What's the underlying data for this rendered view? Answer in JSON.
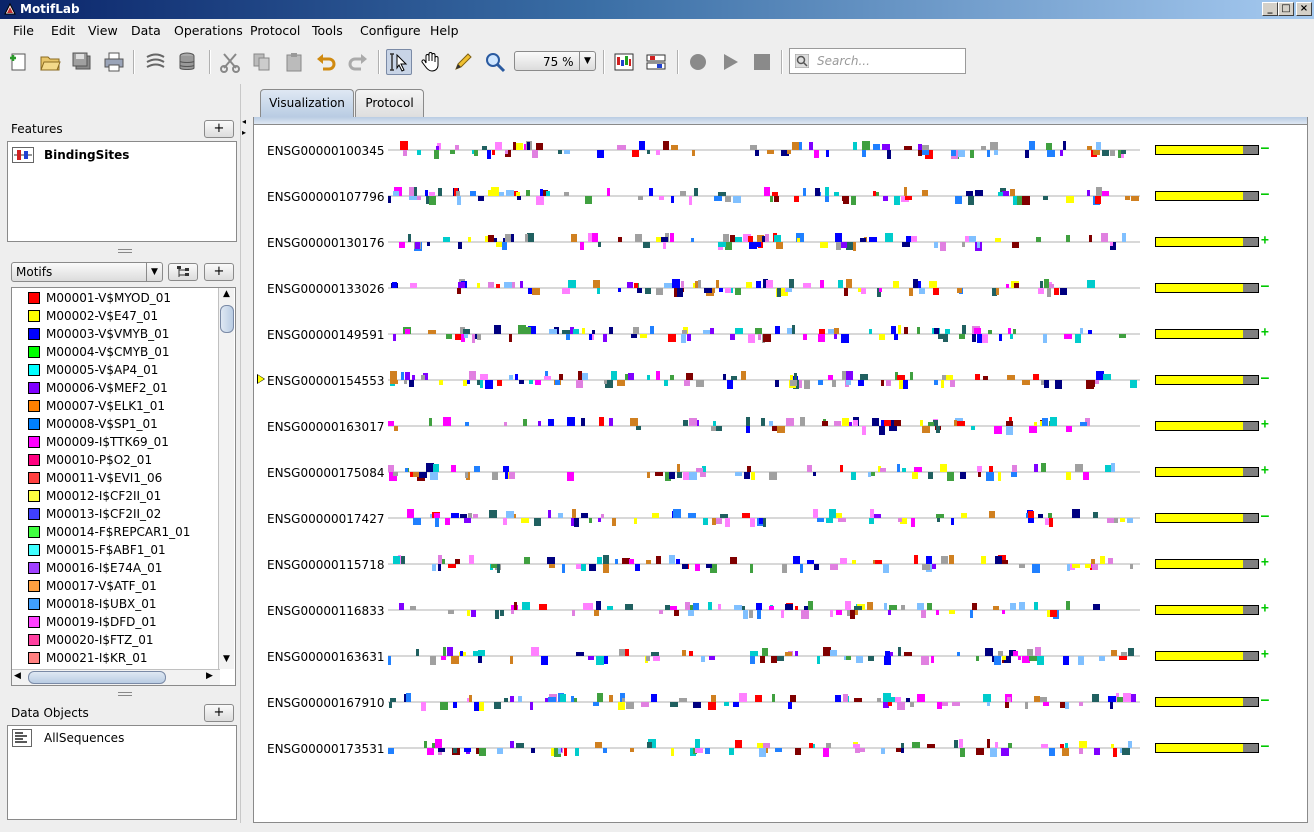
{
  "window": {
    "title": "MotifLab"
  },
  "menu": [
    "File",
    "Edit",
    "View",
    "Data",
    "Operations",
    "Protocol",
    "Tools",
    "Configure",
    "Help"
  ],
  "toolbar": {
    "zoom": "75 %",
    "search_placeholder": "Search..."
  },
  "features": {
    "title": "Features",
    "add_label": "+",
    "items": [
      {
        "label": "BindingSites",
        "icon": "region-track-icon"
      }
    ]
  },
  "motifs": {
    "selector": "Motifs",
    "add_label": "+",
    "items": [
      {
        "label": "M00001-V$MYOD_01",
        "color": "#ff0000"
      },
      {
        "label": "M00002-V$E47_01",
        "color": "#ffff00"
      },
      {
        "label": "M00003-V$VMYB_01",
        "color": "#0000ff"
      },
      {
        "label": "M00004-V$CMYB_01",
        "color": "#00ff00"
      },
      {
        "label": "M00005-V$AP4_01",
        "color": "#00ffff"
      },
      {
        "label": "M00006-V$MEF2_01",
        "color": "#8000ff"
      },
      {
        "label": "M00007-V$ELK1_01",
        "color": "#ff8000"
      },
      {
        "label": "M00008-V$SP1_01",
        "color": "#0080ff"
      },
      {
        "label": "M00009-I$TTK69_01",
        "color": "#ff00ff"
      },
      {
        "label": "M00010-P$O2_01",
        "color": "#ff0080"
      },
      {
        "label": "M00011-V$EVI1_06",
        "color": "#ff4040"
      },
      {
        "label": "M00012-I$CF2II_01",
        "color": "#ffff40"
      },
      {
        "label": "M00013-I$CF2II_02",
        "color": "#4040ff"
      },
      {
        "label": "M00014-F$REPCAR1_01",
        "color": "#40ff40"
      },
      {
        "label": "M00015-F$ABF1_01",
        "color": "#40ffff"
      },
      {
        "label": "M00016-I$E74A_01",
        "color": "#a040ff"
      },
      {
        "label": "M00017-V$ATF_01",
        "color": "#ffa040"
      },
      {
        "label": "M00018-I$UBX_01",
        "color": "#40a0ff"
      },
      {
        "label": "M00019-I$DFD_01",
        "color": "#ff40ff"
      },
      {
        "label": "M00020-I$FTZ_01",
        "color": "#ff40a0"
      },
      {
        "label": "M00021-I$KR_01",
        "color": "#ff8080"
      }
    ]
  },
  "data_objects": {
    "title": "Data Objects",
    "add_label": "+",
    "items": [
      {
        "label": "AllSequences",
        "icon": "sequence-collection-icon"
      }
    ]
  },
  "tabs": [
    {
      "label": "Visualization",
      "active": true
    },
    {
      "label": "Protocol",
      "active": false
    }
  ],
  "sequences": [
    {
      "name": "ENSG00000100345",
      "toggle": "–",
      "selected": false
    },
    {
      "name": "ENSG00000107796",
      "toggle": "–",
      "selected": false
    },
    {
      "name": "ENSG00000130176",
      "toggle": "+",
      "selected": false
    },
    {
      "name": "ENSG00000133026",
      "toggle": "–",
      "selected": false
    },
    {
      "name": "ENSG00000149591",
      "toggle": "+",
      "selected": false
    },
    {
      "name": "ENSG00000154553",
      "toggle": "–",
      "selected": true
    },
    {
      "name": "ENSG00000163017",
      "toggle": "+",
      "selected": false
    },
    {
      "name": "ENSG00000175084",
      "toggle": "+",
      "selected": false
    },
    {
      "name": "ENSG00000017427",
      "toggle": "–",
      "selected": false
    },
    {
      "name": "ENSG00000115718",
      "toggle": "+",
      "selected": false
    },
    {
      "name": "ENSG00000116833",
      "toggle": "+",
      "selected": false
    },
    {
      "name": "ENSG00000163631",
      "toggle": "+",
      "selected": false
    },
    {
      "name": "ENSG00000167910",
      "toggle": "–",
      "selected": false
    },
    {
      "name": "ENSG00000173531",
      "toggle": "–",
      "selected": false
    }
  ],
  "track_palette": [
    "#ff0000",
    "#800000",
    "#0000ff",
    "#00cccc",
    "#8000ff",
    "#ff80ff",
    "#a0a0a0",
    "#40a040",
    "#d08020",
    "#2080ff",
    "#ffff00",
    "#ff00ff",
    "#206060",
    "#000080",
    "#80c0ff",
    "#e080e0"
  ]
}
